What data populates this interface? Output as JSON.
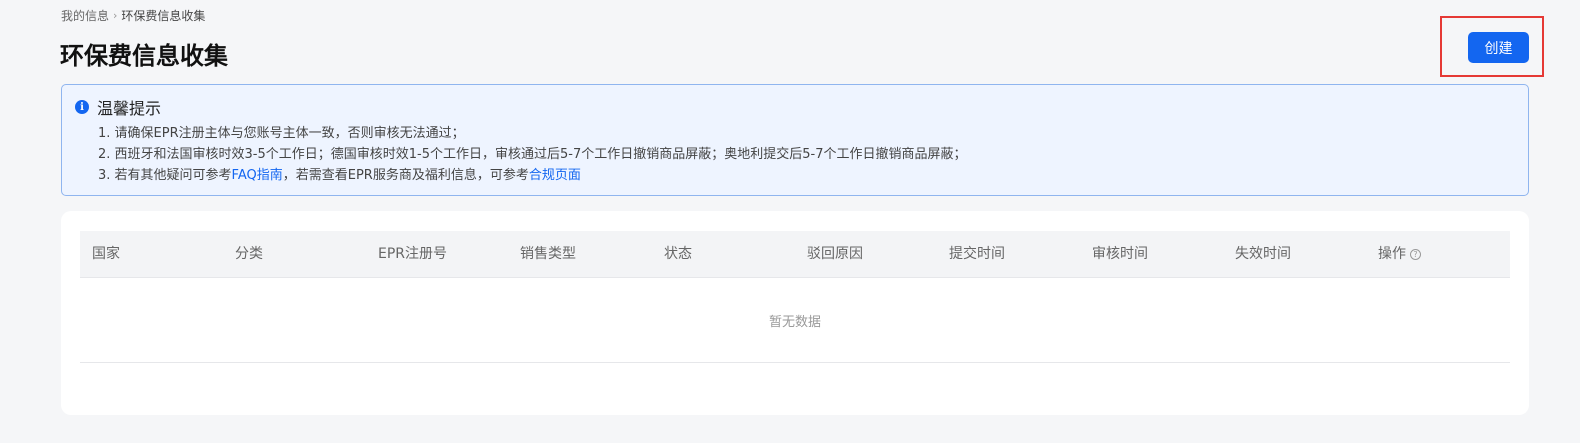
{
  "breadcrumb": {
    "parent": "我的信息",
    "separator": "›",
    "current": "环保费信息收集"
  },
  "page": {
    "title": "环保费信息收集"
  },
  "toolbar": {
    "create_label": "创建"
  },
  "tip": {
    "icon": "info-icon",
    "icon_glyph": "i",
    "title": "温馨提示",
    "line1": "1. 请确保EPR注册主体与您账号主体一致，否则审核无法通过；",
    "line2": "2. 西班牙和法国审核时效3-5个工作日；德国审核时效1-5个工作日，审核通过后5-7个工作日撤销商品屏蔽；奥地利提交后5-7个工作日撤销商品屏蔽；",
    "line3_prefix": "3. 若有其他疑问可参考",
    "line3_link1": "FAQ指南",
    "line3_middle": "，若需查看EPR服务商及福利信息，可参考",
    "line3_link2": "合规页面"
  },
  "table": {
    "columns": [
      "国家",
      "分类",
      "EPR注册号",
      "销售类型",
      "状态",
      "驳回原因",
      "提交时间",
      "审核时间",
      "失效时间",
      "操作"
    ],
    "help_glyph": "?",
    "empty_text": "暂无数据"
  },
  "colors": {
    "accent": "#1366f0",
    "highlight": "#e53935",
    "tip_background": "#eef4ff",
    "tip_border": "#8fb5ef"
  }
}
